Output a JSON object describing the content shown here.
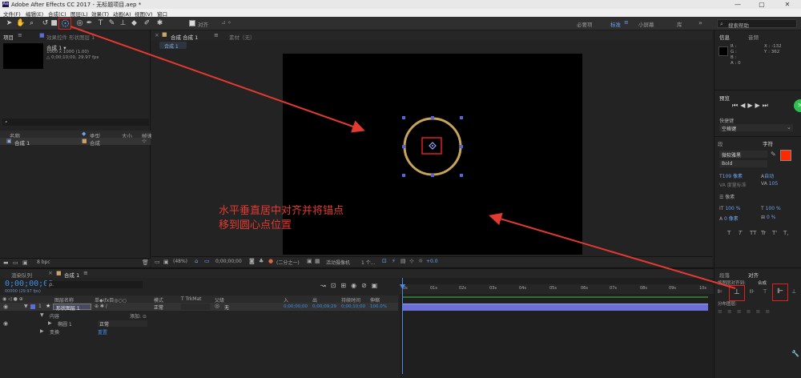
{
  "window": {
    "title": "Adobe After Effects CC 2017 - 无标题项目.aep *",
    "app_icon_text": "Ae",
    "minimize": "—",
    "maximize": "▢",
    "close": "✕"
  },
  "menu": [
    "文件(F)",
    "编辑(E)",
    "合成(C)",
    "图层(L)",
    "效果(T)",
    "动画(A)",
    "视图(V)",
    "窗口"
  ],
  "toolbar": {
    "snap_label": "对齐",
    "workspaces": [
      "必要项",
      "标准",
      "小屏幕",
      "库"
    ],
    "active_workspace": "标准",
    "search_placeholder": "搜索帮助"
  },
  "project": {
    "tabs": [
      "项目",
      "效果控件 形状图层 1"
    ],
    "item_name": "合成 1 ▾",
    "item_size": "1000 x 1000 (1.00)",
    "item_duration": "△ 0;00;10;00, 29.97 fps",
    "columns": [
      "名称",
      "类型",
      "大小",
      "帧速"
    ],
    "rows": [
      {
        "name": "合成 1",
        "type": "合成"
      }
    ],
    "bpc": "8 bpc"
  },
  "composition": {
    "tab": "合成 合成 1",
    "tab_menu": "≡",
    "layer_tab": "素材（无）",
    "subtab": "合成 1",
    "zoom": "(48%)",
    "timecode": "0;00;00;00",
    "resolution": "(二分之一)",
    "camera": "活动摄像机",
    "views": "1 个...",
    "exposure": "+0.0"
  },
  "annotation": {
    "line1": "水平垂直居中对齐并将锚点",
    "line2": "移到圆心点位置",
    "color": "#e33a30"
  },
  "info": {
    "tabs": [
      "信息",
      "音频"
    ],
    "r": "R :",
    "g": "G :",
    "b": "B :",
    "a": "A : 0",
    "x": "X : -132",
    "y": "Y : 362"
  },
  "preview": {
    "tab": "预览",
    "shortcut_label": "快捷键",
    "shortcut_value": "空格键",
    "badge": "36"
  },
  "character": {
    "tabs": [
      "段",
      "字符"
    ],
    "font": "微软雅黑",
    "style": "Bold",
    "size": "109 像素",
    "leading": "自动",
    "kerning": "度量标准",
    "tracking": "105",
    "stroke_unit": "像素",
    "vscale": "100 %",
    "hscale": "100 %",
    "baseline": "0 像素",
    "tsume": "0 %",
    "fill_color": "#ff2a00",
    "styles": [
      "T",
      "T",
      "TT",
      "Tr",
      "T'",
      "T,"
    ]
  },
  "align": {
    "tabs": [
      "段落",
      "对齐"
    ],
    "align_to_label": "将图层对齐到:",
    "align_to_value": "合成",
    "distribute_label": "分布图层:"
  },
  "timeline": {
    "tabs": [
      "渲染队列",
      "合成 1"
    ],
    "timecode": "0;00;00;00",
    "timecode_sub": "00000 (29.97 fps)",
    "search_icon_label": "ρ.",
    "columns": [
      "图层名称",
      "单◆\\fx目◎○○",
      "模式",
      "T TrkMat",
      "父级",
      "入",
      "出",
      "持续时间",
      "伸缩"
    ],
    "layer": {
      "index": "1",
      "name": "形状图层 1",
      "mode": "正常",
      "parent": "无",
      "in": "0;00;00;00",
      "out": "0;00;09;29",
      "duration": "0;00;10;00",
      "stretch": "100.0%"
    },
    "content_label": "内容",
    "add_label": "添加: ⊙",
    "ellipse_label": "椭圆 1",
    "ellipse_mode": "正常",
    "transform_label": "变换",
    "transform_value": "重置",
    "ruler": [
      "0s",
      "01s",
      "02s",
      "03s",
      "04s",
      "05s",
      "06s",
      "07s",
      "08s",
      "09s",
      "10s"
    ]
  },
  "colors": {
    "accent_blue": "#6aa2f0",
    "layer_bar": "#6b6fd6",
    "highlight_red": "#e02020",
    "timecode_blue": "#3d8ee8",
    "circle_stroke": "#c8a45a",
    "badge_green": "#2fbf4f"
  },
  "icons": [
    "selection-tool-icon",
    "hand-tool-icon",
    "zoom-tool-icon",
    "rotate-tool-icon",
    "camera-tool-icon",
    "pan-behind-tool-icon",
    "shape-tool-icon",
    "pen-tool-icon",
    "type-tool-icon",
    "brush-tool-icon",
    "stamp-tool-icon",
    "eraser-tool-icon",
    "puppet-tool-icon",
    "search-icon"
  ]
}
